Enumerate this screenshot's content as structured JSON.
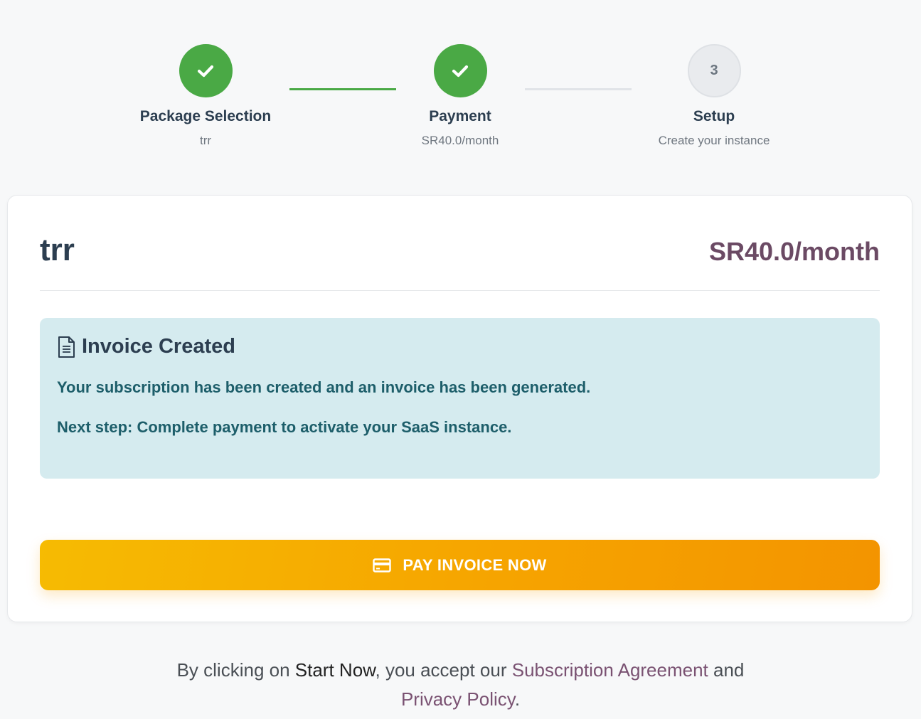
{
  "stepper": {
    "steps": [
      {
        "title": "Package Selection",
        "subtitle": "trr",
        "status": "done"
      },
      {
        "title": "Payment",
        "subtitle": "SR40.0/month",
        "status": "done"
      },
      {
        "title": "Setup",
        "subtitle": "Create your instance",
        "status": "pending",
        "number": "3"
      }
    ]
  },
  "package": {
    "name": "trr",
    "price": "SR40.0/month"
  },
  "invoice_alert": {
    "icon": "document-icon",
    "title": "Invoice Created",
    "message": "Your subscription has been created and an invoice has been generated.",
    "next_step_label": "Next step:",
    "next_step_text": " Complete payment to activate your SaaS instance."
  },
  "pay_button": {
    "icon": "credit-card-icon",
    "label": "PAY INVOICE NOW"
  },
  "terms": {
    "prefix": "By clicking on ",
    "start_now": "Start Now",
    "middle": ", you accept our ",
    "agreement_link": "Subscription Agreement",
    "and": " and",
    "privacy_link": "Privacy Policy",
    "suffix": "."
  },
  "colors": {
    "success": "#4aa945",
    "accent_price": "#6b4a64",
    "alert_bg": "#d5ebef",
    "button_start": "#f6bb02",
    "button_end": "#f39400",
    "link": "#7a5272"
  }
}
